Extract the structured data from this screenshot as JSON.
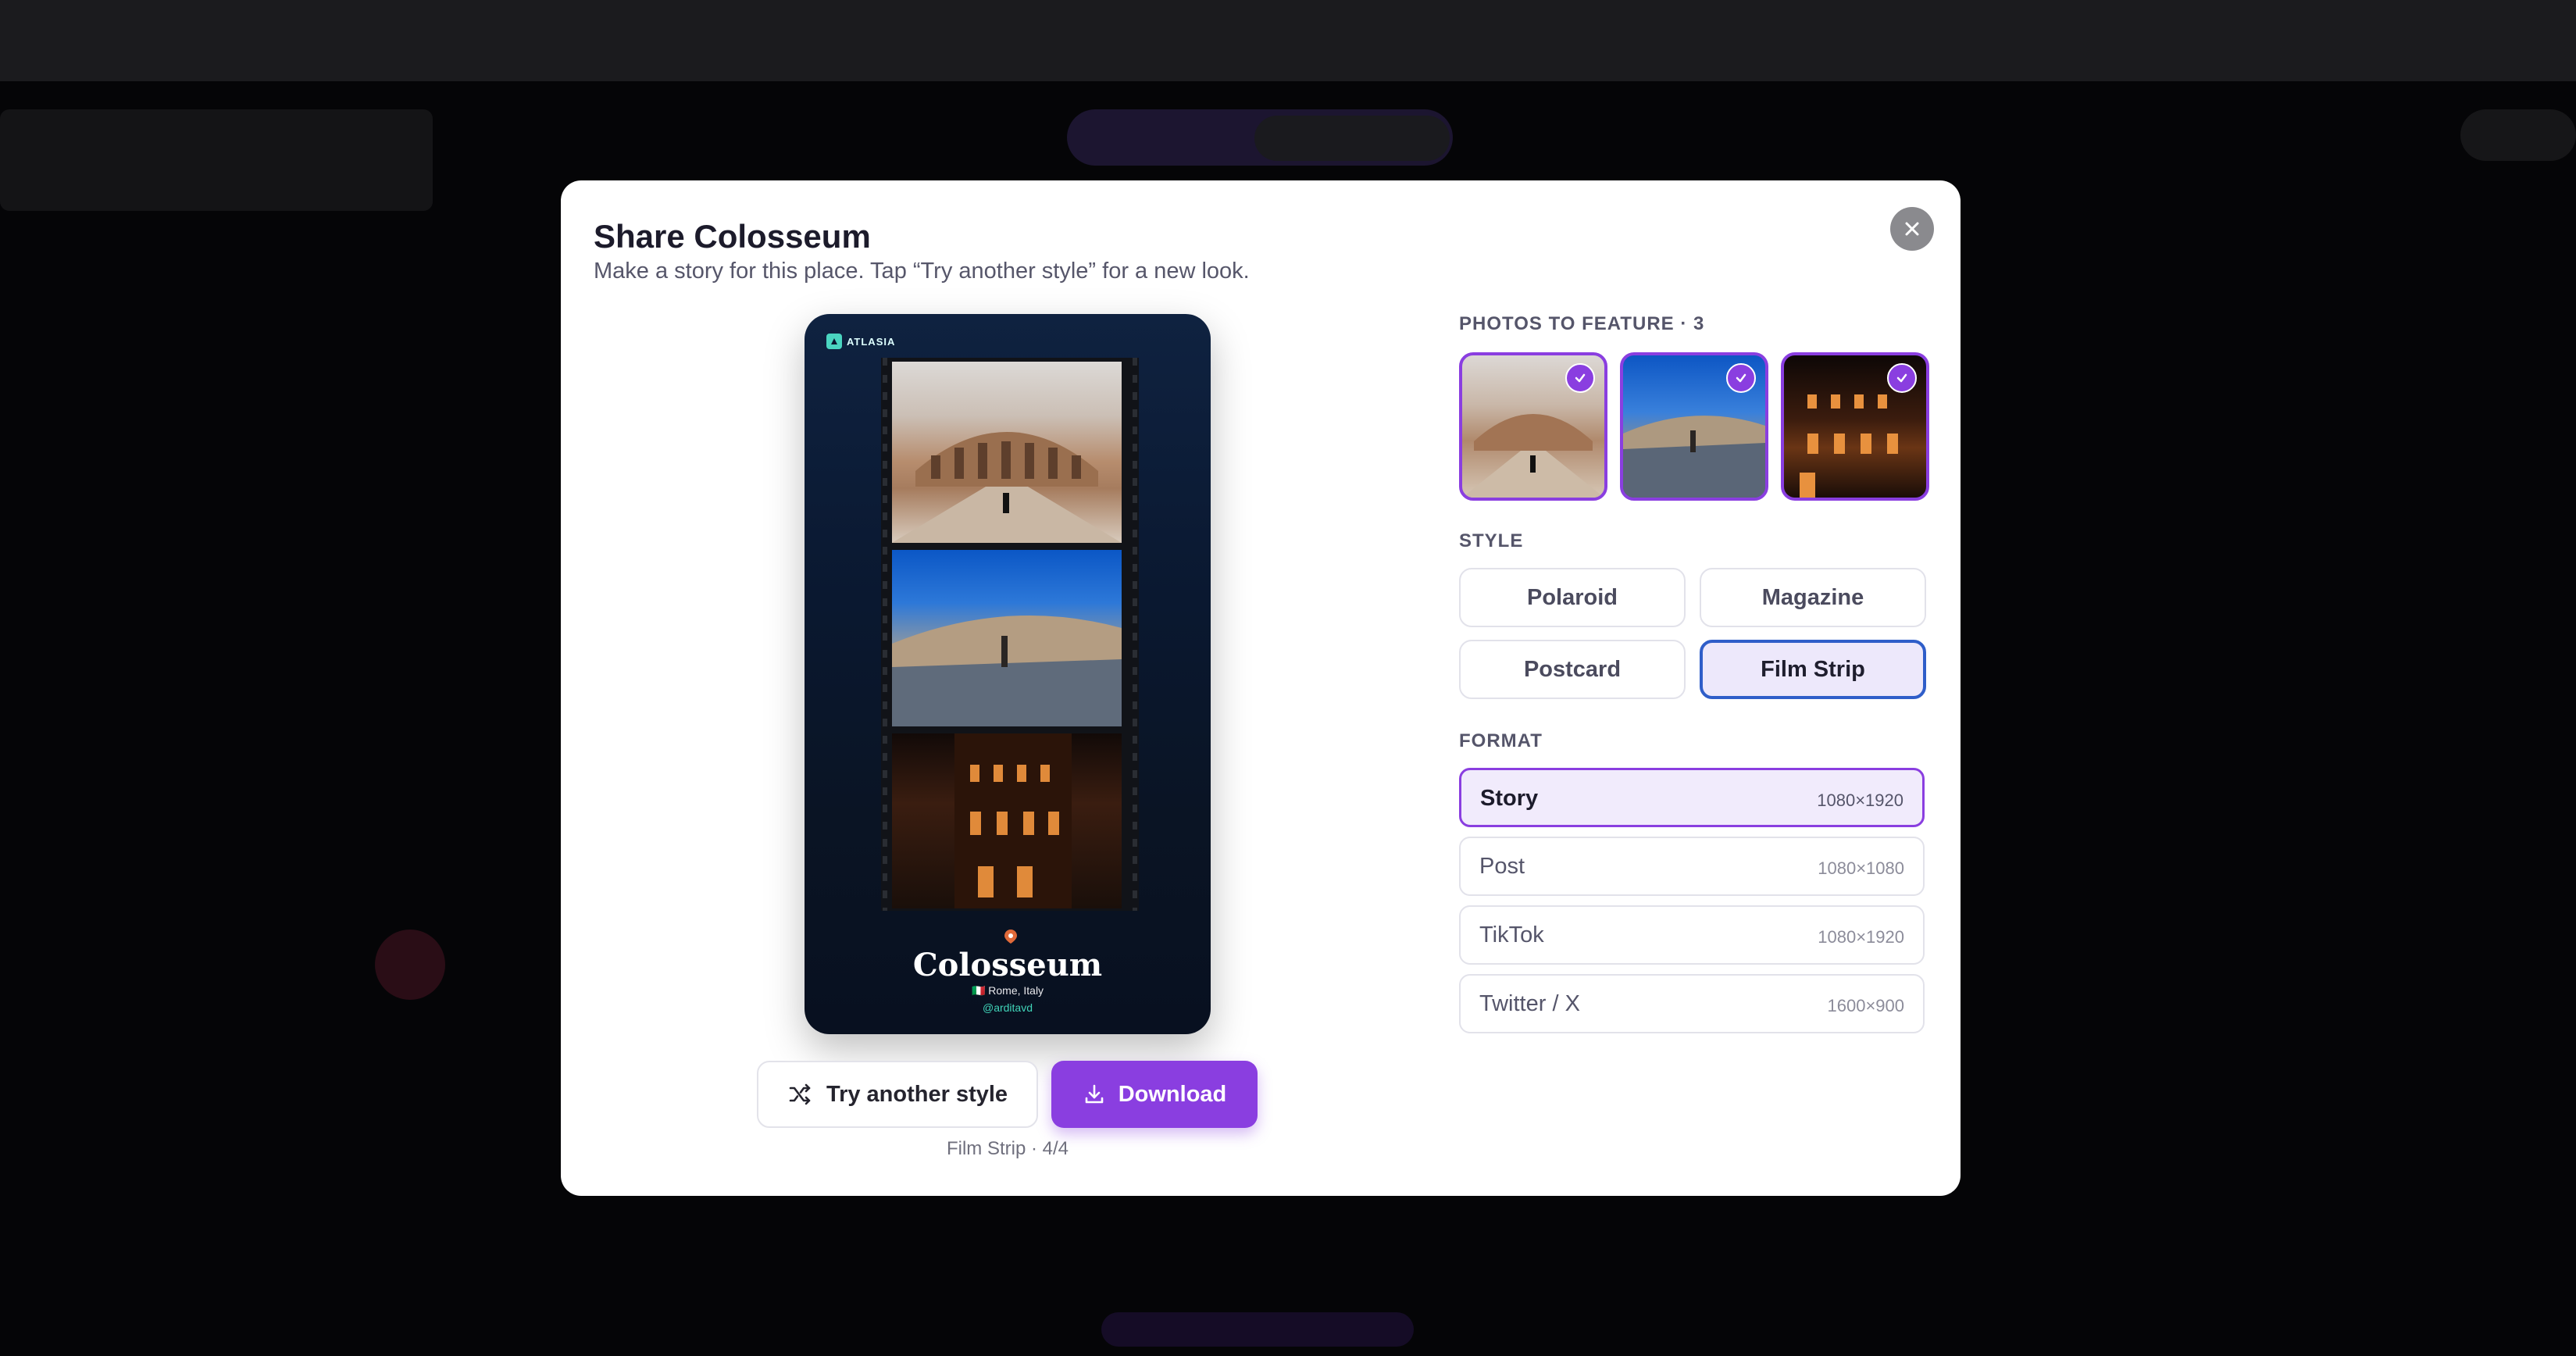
{
  "modal": {
    "title": "Share Colosseum",
    "subtitle": "Make a story for this place. Tap “Try another style” for a new look."
  },
  "preview": {
    "brand": "ATLASIA",
    "place_name": "Colosseum",
    "location": "🇮🇹 Rome, Italy",
    "handle": "@arditavd"
  },
  "actions": {
    "try_label": "Try another style",
    "download_label": "Download",
    "caption": "Film Strip · 4/4"
  },
  "photos": {
    "heading": "PHOTOS TO FEATURE · 3",
    "items": [
      {
        "subject": "Colosseum exterior, daytime",
        "selected": true
      },
      {
        "subject": "Colosseum interior arena, blue sky",
        "selected": true
      },
      {
        "subject": "Colosseum arches lit at night",
        "selected": true
      }
    ]
  },
  "style": {
    "heading": "STYLE",
    "options": [
      "Polaroid",
      "Magazine",
      "Postcard",
      "Film Strip"
    ],
    "selected": "Film Strip"
  },
  "format": {
    "heading": "FORMAT",
    "options": [
      {
        "name": "Story",
        "size": "1080×1920",
        "selected": true
      },
      {
        "name": "Post",
        "size": "1080×1080",
        "selected": false
      },
      {
        "name": "TikTok",
        "size": "1080×1920",
        "selected": false
      },
      {
        "name": "Twitter / X",
        "size": "1600×900",
        "selected": false
      }
    ]
  },
  "icons": {
    "close": "close-icon",
    "shuffle": "shuffle-icon",
    "download": "download-icon",
    "check": "check-icon",
    "pin": "map-pin-icon"
  },
  "colors": {
    "accent": "#8a3ee0",
    "selected_style_border": "#2f5ec9",
    "teal": "#40d4b8"
  }
}
